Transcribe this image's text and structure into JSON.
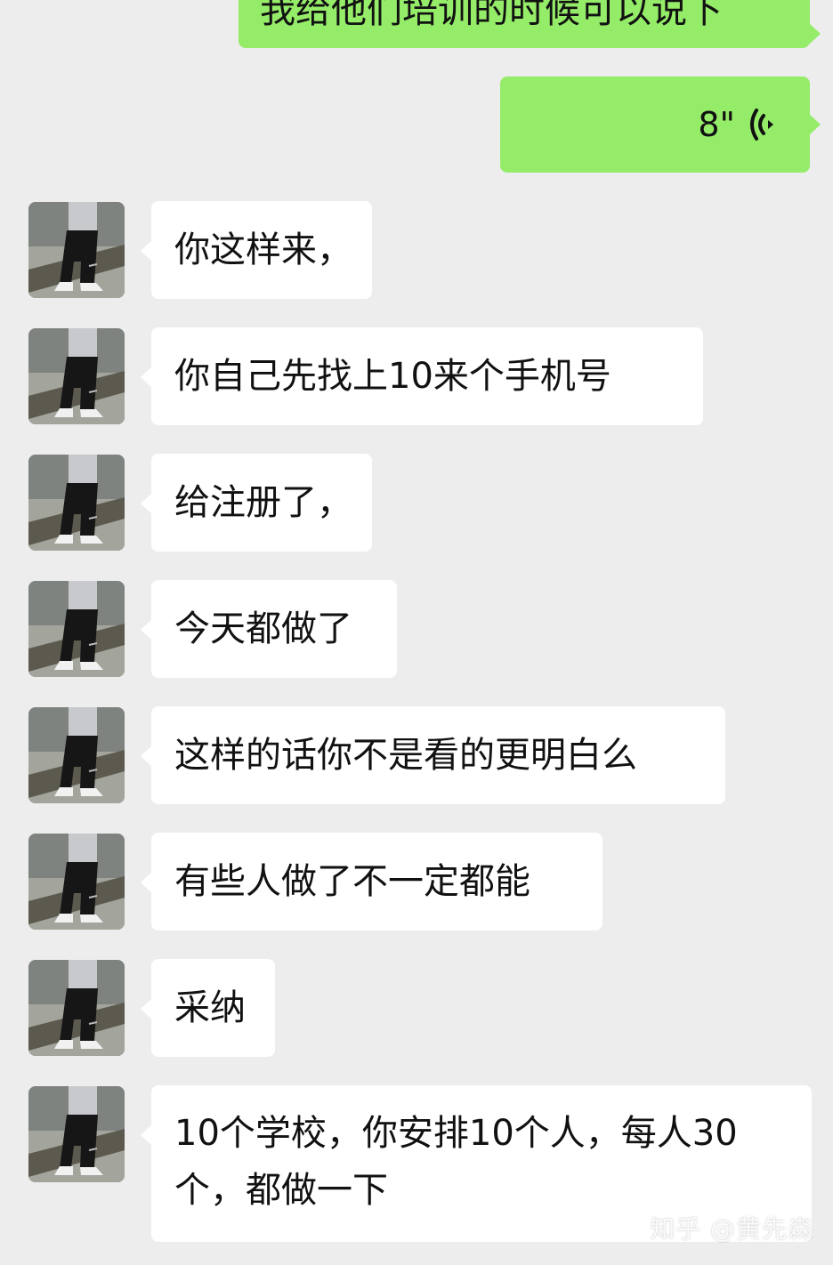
{
  "messages": [
    {
      "from": "me",
      "type": "text",
      "text": "我给他们培训的时候可以说下"
    },
    {
      "from": "me",
      "type": "voice",
      "duration": "8\""
    },
    {
      "from": "other",
      "type": "text",
      "text": "你这样来，"
    },
    {
      "from": "other",
      "type": "text",
      "text": "你自己先找上10来个手机号"
    },
    {
      "from": "other",
      "type": "text",
      "text": "给注册了，"
    },
    {
      "from": "other",
      "type": "text",
      "text": "今天都做了"
    },
    {
      "from": "other",
      "type": "text",
      "text": "这样的话你不是看的更明白么"
    },
    {
      "from": "other",
      "type": "text",
      "text": "有些人做了不一定都能"
    },
    {
      "from": "other",
      "type": "text",
      "text": "采纳"
    },
    {
      "from": "other",
      "type": "text",
      "text": "10个学校，你安排10个人，每人30个，都做一下"
    }
  ],
  "watermark": "知乎 @黄先森",
  "colors": {
    "background": "#ededed",
    "outgoing_bubble": "#95ec69",
    "incoming_bubble": "#ffffff"
  },
  "icons": {
    "voice": "voice-wave-icon",
    "avatar": "person-legs-photo-avatar"
  }
}
